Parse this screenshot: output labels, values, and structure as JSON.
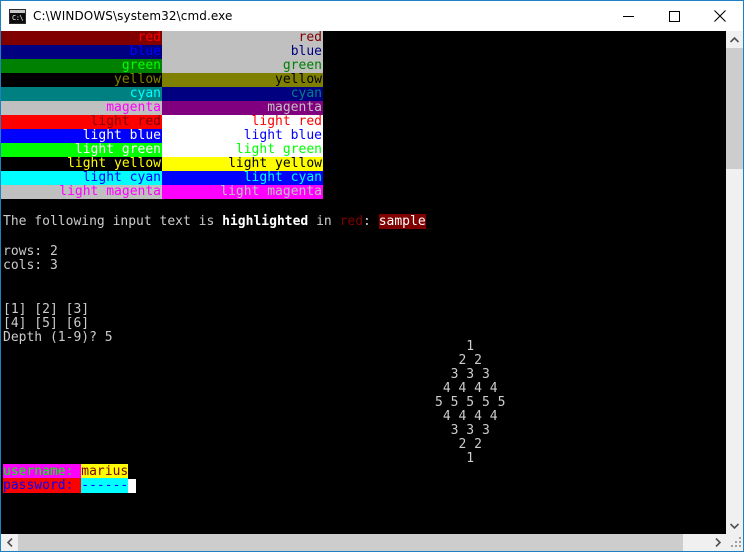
{
  "window": {
    "title": "C:\\WINDOWS\\system32\\cmd.exe",
    "icon": "cmd-icon",
    "prompt_glyph": "C:\\",
    "minimize_label": "Minimize",
    "maximize_label": "Maximize",
    "close_label": "Close"
  },
  "palette": {
    "black": "#000000",
    "dark_red": "#800000",
    "dark_green": "#008000",
    "dark_yellow": "#808000",
    "dark_blue": "#000080",
    "dark_magenta": "#800080",
    "dark_cyan": "#008080",
    "silver": "#c0c0c0",
    "gray": "#808080",
    "red": "#ff0000",
    "green": "#00ff00",
    "yellow": "#ffff00",
    "blue": "#0000ff",
    "magenta": "#ff00ff",
    "cyan": "#00ffff",
    "white": "#ffffff",
    "console_bg": "#000000",
    "console_fg": "#cccccc"
  },
  "color_table": {
    "rows": [
      {
        "label": "red",
        "left_bg": "#800000",
        "left_fg": "#ff0000",
        "right_bg": "#c0c0c0",
        "right_fg": "#800000"
      },
      {
        "label": "blue",
        "left_bg": "#000080",
        "left_fg": "#0000ff",
        "right_bg": "#c0c0c0",
        "right_fg": "#000080"
      },
      {
        "label": "green",
        "left_bg": "#008000",
        "left_fg": "#00ff00",
        "right_bg": "#c0c0c0",
        "right_fg": "#008000"
      },
      {
        "label": "yellow",
        "left_bg": "#000000",
        "left_fg": "#808000",
        "right_bg": "#808000",
        "right_fg": "#000000"
      },
      {
        "label": "cyan",
        "left_bg": "#008080",
        "left_fg": "#00ffff",
        "right_bg": "#000080",
        "right_fg": "#008080"
      },
      {
        "label": "magenta",
        "left_bg": "#c0c0c0",
        "left_fg": "#ff00ff",
        "right_bg": "#800080",
        "right_fg": "#c0c0c0"
      },
      {
        "label": "light red",
        "left_bg": "#ff0000",
        "left_fg": "#800000",
        "right_bg": "#ffffff",
        "right_fg": "#ff0000"
      },
      {
        "label": "light blue",
        "left_bg": "#0000ff",
        "left_fg": "#ffffff",
        "right_bg": "#ffffff",
        "right_fg": "#0000ff"
      },
      {
        "label": "light green",
        "left_bg": "#00ff00",
        "left_fg": "#ffffff",
        "right_bg": "#ffffff",
        "right_fg": "#00ff00"
      },
      {
        "label": "light yellow",
        "left_bg": "#000000",
        "left_fg": "#ffff00",
        "right_bg": "#ffff00",
        "right_fg": "#000000"
      },
      {
        "label": "light cyan",
        "left_bg": "#00ffff",
        "left_fg": "#0000ff",
        "right_bg": "#0000ff",
        "right_fg": "#00ffff"
      },
      {
        "label": "light magenta",
        "left_bg": "#c0c0c0",
        "left_fg": "#ff00ff",
        "right_bg": "#ff00ff",
        "right_fg": "#c0c0c0"
      }
    ]
  },
  "highlight_line": {
    "part1": "The following input text is ",
    "bold_word": "highlighted",
    "part2": " in ",
    "red_word": "red",
    "part3": ": ",
    "sample": "sample",
    "sample_bg": "#800000",
    "sample_fg": "#ffffff",
    "red_word_color": "#800000",
    "bold_color": "#ffffff"
  },
  "dimensions": {
    "rows_label": "rows: 2",
    "cols_label": "cols: 3"
  },
  "matrix": {
    "row1": "[1] [2] [3]",
    "row2": "[4] [5] [6]"
  },
  "depth_prompt": {
    "question": "Depth (1-9)? ",
    "answer": "5"
  },
  "diamond": {
    "lines": [
      "    1",
      "   2 2",
      "  3 3 3",
      " 4 4 4 4",
      "5 5 5 5 5",
      " 4 4 4 4",
      "  3 3 3",
      "   2 2",
      "    1"
    ]
  },
  "login": {
    "username_label": "username: ",
    "username_label_fg": "#00ff00",
    "username_label_bg": "#ff00ff",
    "username_value": "marius",
    "username_value_fg": "#800000",
    "username_value_bg": "#ffff00",
    "password_label": "password: ",
    "password_label_fg": "#0000ff",
    "password_label_bg": "#ff0000",
    "password_value": "------",
    "password_value_fg": "#0000ff",
    "password_value_bg": "#00ffff",
    "cursor_color": "#ffffff"
  },
  "scrollbars": {
    "vertical_up": "scroll-up",
    "vertical_down": "scroll-down",
    "horizontal_left": "scroll-left",
    "horizontal_right": "scroll-right",
    "resize_grip": "resize-grip"
  }
}
